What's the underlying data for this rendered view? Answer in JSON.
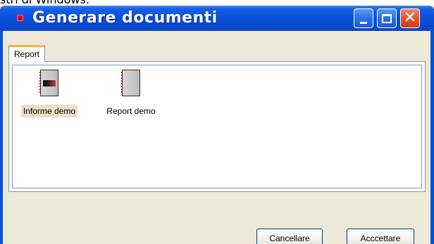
{
  "window": {
    "title": "Generare documenti",
    "top_caption": "stri di Windows."
  },
  "tabs": [
    {
      "label": "Report",
      "active": true
    }
  ],
  "documents": [
    {
      "label": "Informe demo",
      "selected": true,
      "icon": "report-document-icon-badged"
    },
    {
      "label": "Report demo",
      "selected": false,
      "icon": "report-document-icon"
    }
  ],
  "buttons": {
    "cancel": "Cancellare",
    "accept": "Acccettare"
  },
  "colors": {
    "titlebar": "#0a50db",
    "client": "#ece9d8",
    "close_button": "#e15a33",
    "tab_accent": "#f6b03c",
    "selection": "#ecdfc9"
  }
}
